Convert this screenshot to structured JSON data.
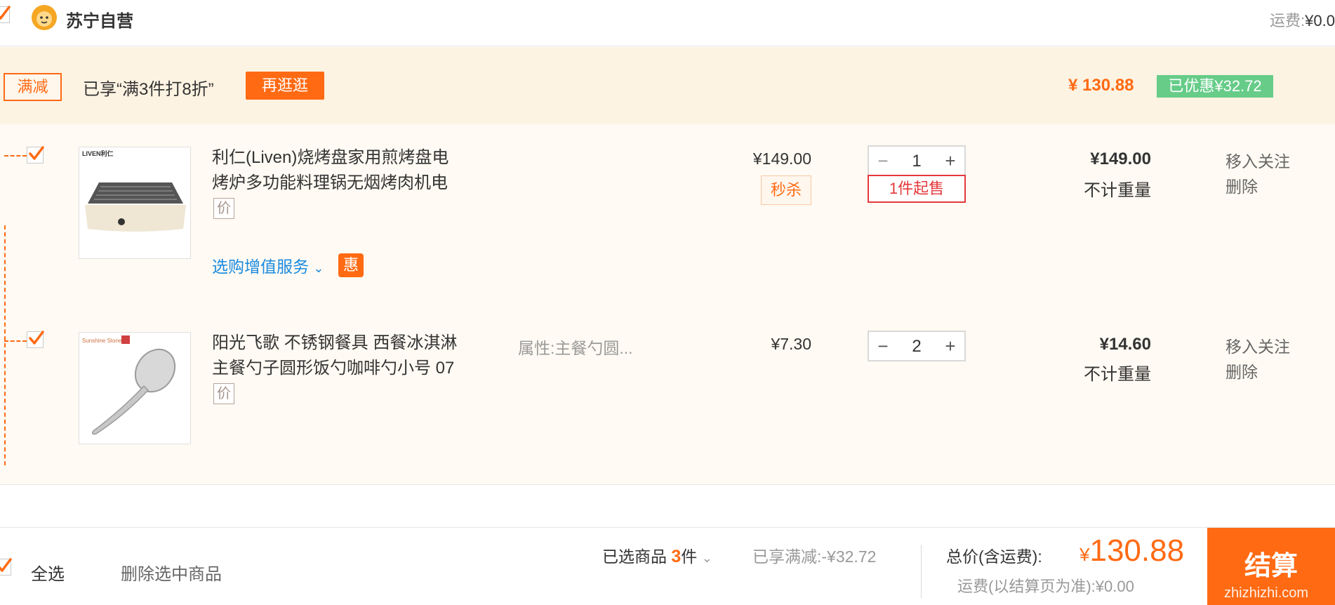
{
  "store": {
    "name": "苏宁自营",
    "shipping_label": "运费:",
    "shipping_value": "¥0.0"
  },
  "promo": {
    "tag": "满减",
    "text": "已享“满3件打8折”",
    "button": "再逛逛",
    "total": "¥ 130.88",
    "saved": "已优惠¥32.72"
  },
  "items": [
    {
      "title": "利仁(Liven)烧烤盘家用煎烤盘电烤炉多功能料理锅无烟烤肉机电",
      "price_icon": "价",
      "unit_price": "¥149.00",
      "badge": "秒杀",
      "quantity": "1",
      "min_sale": "1件起售",
      "subtotal": "¥149.00",
      "weight": "不计重量",
      "action_follow": "移入关注",
      "action_delete": "删除",
      "value_added": "选购增值服务",
      "value_added_badge": "惠",
      "brand_text": "LIVEN利仁"
    },
    {
      "title": "阳光飞歌 不锈钢餐具 西餐冰淇淋主餐勺子圆形饭勺咖啡勺小号 07",
      "price_icon": "价",
      "attribute": "属性:主餐勺圆...",
      "unit_price": "¥7.30",
      "quantity": "2",
      "subtotal": "¥14.60",
      "weight": "不计重量",
      "action_follow": "移入关注",
      "action_delete": "删除",
      "brand_text": "Sunshine Stone"
    }
  ],
  "footer": {
    "select_all": "全选",
    "delete_selected": "删除选中商品",
    "selected_prefix": "已选商品",
    "selected_count": "3",
    "selected_suffix": "件",
    "discount": "已享满减:-¥32.72",
    "total_label": "总价(含运费):",
    "total_currency": "¥",
    "total_amount": "130.88",
    "freight_note": "运费(以结算页为准):¥0.00",
    "checkout": "结算",
    "watermark": "zhizhizhi.com"
  },
  "colors": {
    "accent": "#ff6a13",
    "promo_bg": "#fdf3e2",
    "items_bg": "#fffaf3",
    "saved_bg": "#66cc88",
    "link": "#1a8adf",
    "min_sale": "#e4393c"
  }
}
